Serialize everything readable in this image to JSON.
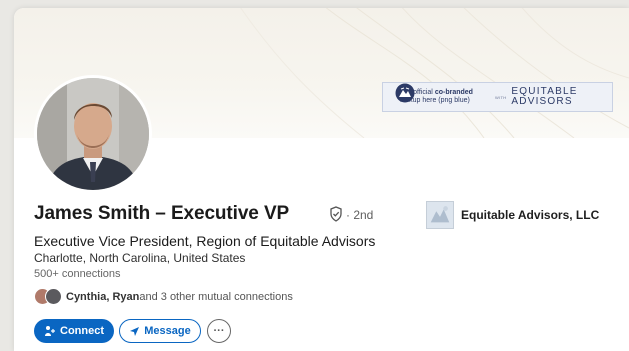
{
  "banner": {
    "lockup_text_prefix": "Your official ",
    "lockup_text_bold": "co-branded",
    "lockup_text_line2": "lockup here (png blue)",
    "lockup_with": "WITH",
    "brand_line1": "EQUITABLE",
    "brand_line2": "ADVISORS"
  },
  "profile": {
    "name": "James Smith –  Executive VP",
    "degree": "· 2nd",
    "headline": "Executive Vice President, Region of Equitable Advisors",
    "location": "Charlotte, North Carolina, United States",
    "connections": "500+ connections",
    "mutual_names": "Cynthia, Ryan",
    "mutual_rest": " and 3 other mutual connections",
    "company": "Equitable Advisors, LLC"
  },
  "actions": {
    "connect_label": "Connect",
    "message_label": "Message",
    "more_label": "···"
  },
  "colors": {
    "accent": "#0a66c2",
    "brand": "#2c3a66"
  },
  "icons": [
    "verified-badge-icon",
    "connect-person-icon",
    "send-icon",
    "more-icon",
    "equitable-logo-icon"
  ]
}
